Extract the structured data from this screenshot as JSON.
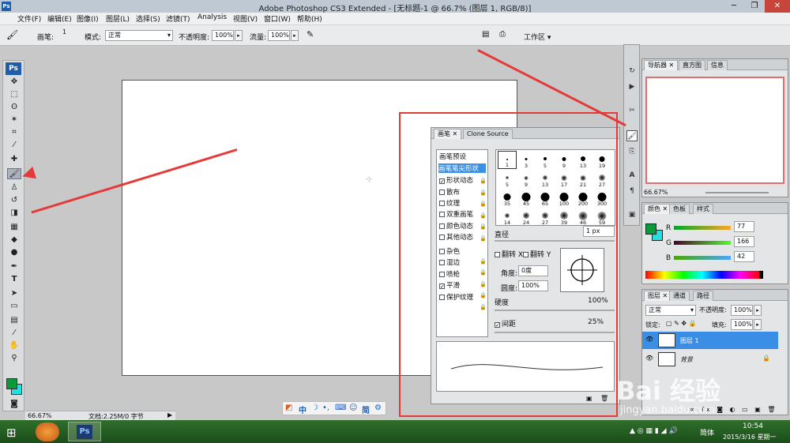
{
  "window": {
    "title": "Adobe Photoshop CS3 Extended - [无标题-1 @ 66.7% (图层 1, RGB/8)]",
    "ps_icon": "Ps",
    "min_icon": "minimize-icon",
    "restore_icon": "restore-icon",
    "close_icon": "close-icon"
  },
  "menu": [
    "文件(F)",
    "编辑(E)",
    "图像(I)",
    "图层(L)",
    "选择(S)",
    "滤镜(T)",
    "Analysis",
    "视图(V)",
    "窗口(W)",
    "帮助(H)"
  ],
  "options": {
    "brush_label": "画笔:",
    "brush_size": "1",
    "mode_label": "模式:",
    "mode_value": "正常",
    "opacity_label": "不透明度:",
    "opacity_value": "100%",
    "flow_label": "流量:",
    "flow_value": "100%",
    "workspace_label": "工作区"
  },
  "toolbox": {
    "logo": "Ps",
    "tools": [
      "move-tool",
      "marquee-tool",
      "lasso-tool",
      "magic-wand-tool",
      "crop-tool",
      "eyedropper-tool",
      "healing-tool",
      "brush-tool",
      "stamp-tool",
      "history-brush-tool",
      "eraser-tool",
      "gradient-tool",
      "blur-tool",
      "dodge-tool",
      "pen-tool",
      "type-tool",
      "path-select-tool",
      "shape-tool",
      "notes-tool",
      "eyedropper2-tool",
      "hand-tool",
      "zoom-tool"
    ],
    "fg_color": "#0a9a3c",
    "bg_color": "#22e0e0"
  },
  "status": {
    "zoom": "66.67%",
    "doc": "文档:2.25M/0 字节"
  },
  "brush_panel": {
    "tab_brush": "画笔",
    "tab_clone": "Clone Source",
    "presets_title": "画笔预设",
    "tip_shape": "画笔笔尖形状",
    "options": [
      {
        "label": "形状动态",
        "checked": true
      },
      {
        "label": "散布",
        "checked": false
      },
      {
        "label": "纹理",
        "checked": false
      },
      {
        "label": "双重画笔",
        "checked": false
      },
      {
        "label": "颜色动态",
        "checked": false
      },
      {
        "label": "其他动态",
        "checked": false
      },
      {
        "label": "杂色",
        "checked": false
      },
      {
        "label": "湿边",
        "checked": false
      },
      {
        "label": "喷枪",
        "checked": false
      },
      {
        "label": "平滑",
        "checked": true
      },
      {
        "label": "保护纹理",
        "checked": false
      }
    ],
    "brush_sizes": [
      "1",
      "3",
      "5",
      "9",
      "13",
      "19",
      "5",
      "9",
      "13",
      "17",
      "21",
      "27",
      "35",
      "45",
      "65",
      "100",
      "200",
      "300",
      "14",
      "24",
      "27",
      "39",
      "46",
      "59"
    ],
    "diameter_label": "直径",
    "diameter_value": "1 px",
    "flip_x": "翻转 X",
    "flip_y": "翻转 Y",
    "angle_label": "角度:",
    "angle_value": "0度",
    "roundness_label": "圆度:",
    "roundness_value": "100%",
    "hardness_label": "硬度",
    "hardness_value": "100%",
    "spacing_label": "间距",
    "spacing_value": "25%"
  },
  "navigator": {
    "tabs": [
      "导航器",
      "直方图",
      "信息"
    ],
    "zoom": "66.67%"
  },
  "color_panel": {
    "tabs": [
      "颜色",
      "色板",
      "样式"
    ],
    "r_label": "R",
    "r_value": "77",
    "g_label": "G",
    "g_value": "166",
    "b_label": "B",
    "b_value": "42",
    "fg": "#0a9a3c"
  },
  "layers_panel": {
    "tabs": [
      "图层",
      "通道",
      "路径"
    ],
    "blend": "正常",
    "opacity_label": "不透明度:",
    "opacity_value": "100%",
    "lock_label": "锁定:",
    "fill_label": "填充:",
    "fill_value": "100%",
    "layers": [
      "图层 1",
      "背景"
    ]
  },
  "ime": {
    "labels": [
      "中",
      "简"
    ]
  },
  "taskbar": {
    "time": "10:54",
    "date": "2015/3/16 星期一",
    "lang": "简体",
    "ps": "Ps"
  },
  "watermark": {
    "text": "Bai 经验",
    "url": "jingyan.baidu.com"
  }
}
